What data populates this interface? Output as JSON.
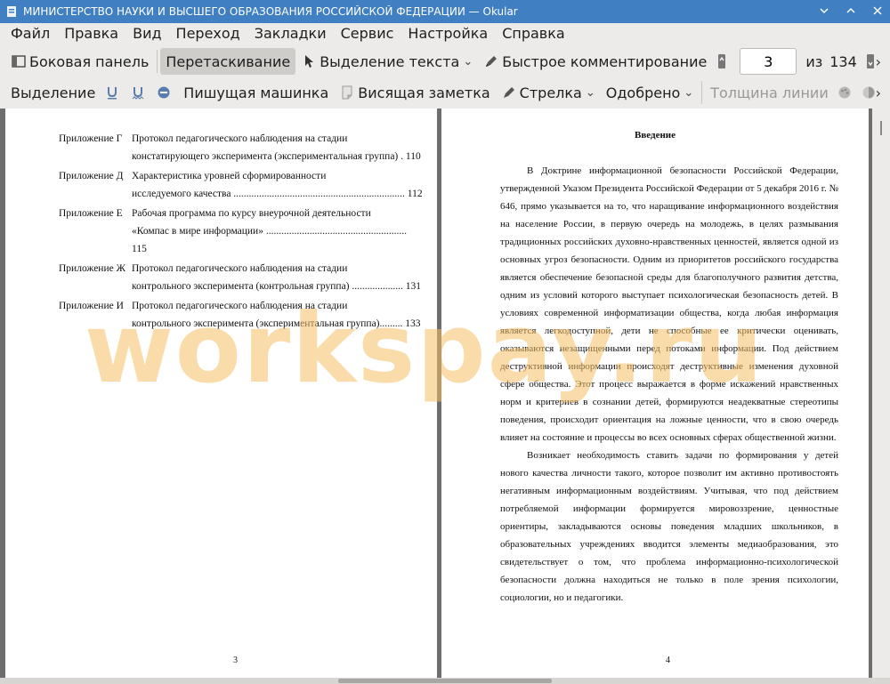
{
  "window": {
    "title": "МИНИСТЕРСТВО НАУКИ И ВЫСШЕГО ОБРАЗОВАНИЯ РОССИЙСКОЙ ФЕДЕРАЦИИ  — Okular"
  },
  "menu": [
    "Файл",
    "Правка",
    "Вид",
    "Переход",
    "Закладки",
    "Сервис",
    "Настройка",
    "Справка"
  ],
  "toolbar1": {
    "sidebar": "Боковая панель",
    "drag": "Перетаскивание",
    "text_select": "Выделение текста",
    "quick_comment": "Быстрое комментирование",
    "page_current": "3",
    "page_of": "из",
    "page_total": "134"
  },
  "toolbar2": {
    "highlight": "Выделение",
    "typewriter": "Пишущая машинка",
    "inline_note": "Висящая заметка",
    "arrow": "Стрелка",
    "approved": "Одобрено",
    "line_width": "Толщина линии"
  },
  "left_page": {
    "toc": [
      {
        "label": "Приложение Г",
        "lines": [
          "Протокол педагогического наблюдения на стадии",
          "констатирующего эксперимента (экспериментальная группа) . 110"
        ]
      },
      {
        "label": "Приложение Д",
        "lines": [
          "Характеристика уровней сформированности",
          "исследуемого качества ................................................................... 112"
        ]
      },
      {
        "label": "Приложение Е",
        "lines": [
          "Рабочая программа по курсу внеурочной деятельности",
          "«Компас в мире информации» ....................................................... 115"
        ]
      },
      {
        "label": "Приложение Ж",
        "lines": [
          "Протокол педагогического наблюдения на стадии",
          "контрольного эксперимента (контрольная группа) .................... 131"
        ]
      },
      {
        "label": "Приложение И",
        "lines": [
          "Протокол педагогического наблюдения на стадии",
          "контрольного эксперимента (экспериментальная группа)......... 133"
        ]
      }
    ],
    "page_number": "3"
  },
  "right_page": {
    "heading": "Введение",
    "paragraphs": [
      "В Доктрине информационной безопасности Российской Федерации, утвержденной Указом Президента Российской Федерации от 5 декабря 2016 г. № 646, прямо указывается на то, что наращивание информационного воздействия на население России, в первую очередь на молодежь, в целях размывания традиционных российских духовно-нравственных ценностей, является одной из основных угроз безопасности. Одним из приоритетов российского государства является обеспечение безопасной среды для благополучного развития детства, одним из условий которого выступает психологическая безопасность детей. В условиях современной информатизации общества, когда любая информация является легкодоступной, дети не способные ее критически оценивать, оказываются незащищенными перед потоками информации. Под действием деструктивной информации происходят деструктивные изменения духовной сфере общества. Этот процесс выражается в форме искажений нравственных норм и критериев в сознании детей, формируются неадекватные стереотипы поведения, происходит ориентация на ложные ценности, что в свою очередь влияет на состояние и процессы во всех основных сферах общественной жизни.",
      "Возникает необходимость ставить задачи по формирования у детей нового качества личности такого, которое позволит им активно противостоять негативным информационным воздействиям. Учитывая, что под действием потребляемой информации формируется мировоззрение, ценностные ориентиры, закладываются основы поведения младших школьников, в образовательных учреждениях вводится элементы медиаобразования, это свидетельствует о том, что проблема информационно-психологической безопасности должна находиться не только в поле зрения психологии, социологии, но и педагогики."
    ],
    "page_number": "4"
  },
  "watermark": "workspay.ru"
}
